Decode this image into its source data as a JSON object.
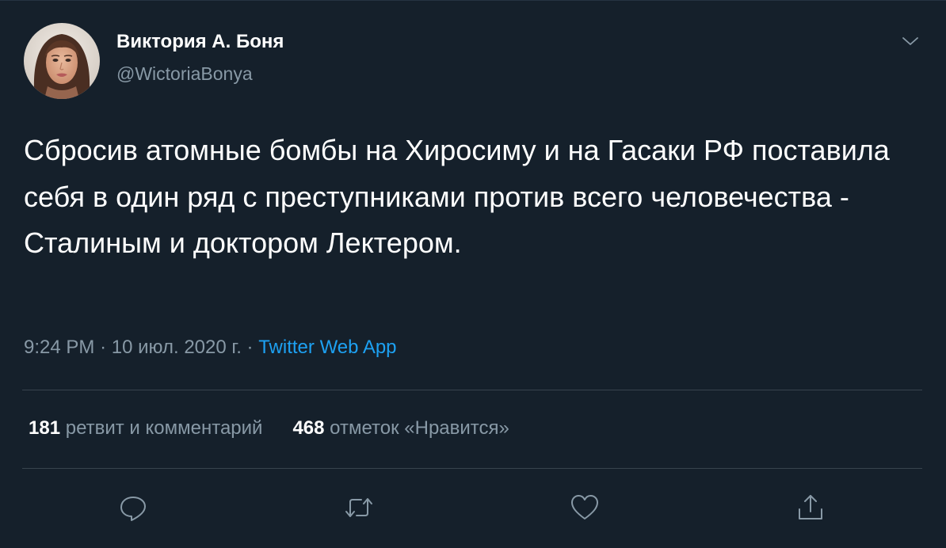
{
  "tweet": {
    "display_name": "Виктория А. Боня",
    "handle": "@WictoriaBonya",
    "text": "Сбросив атомные бомбы на Хиросиму и на Гасаки РФ поставила себя в один ряд с преступниками против всего человечества - Сталиным и доктором Лектером.",
    "time": "9:24 PM",
    "date": "10 июл. 2020 г.",
    "separator": "·",
    "source": "Twitter Web App"
  },
  "stats": {
    "retweets_count": "181",
    "retweets_label": "ретвит и комментарий",
    "likes_count": "468",
    "likes_label": "отметок «Нравится»"
  },
  "icons": {
    "menu": "chevron-down-icon",
    "reply": "reply-icon",
    "retweet": "retweet-icon",
    "like": "heart-icon",
    "share": "share-icon"
  },
  "colors": {
    "background": "#15202b",
    "text_primary": "#ffffff",
    "text_secondary": "#8899a6",
    "link": "#1da1f2",
    "divider": "#38444d"
  }
}
